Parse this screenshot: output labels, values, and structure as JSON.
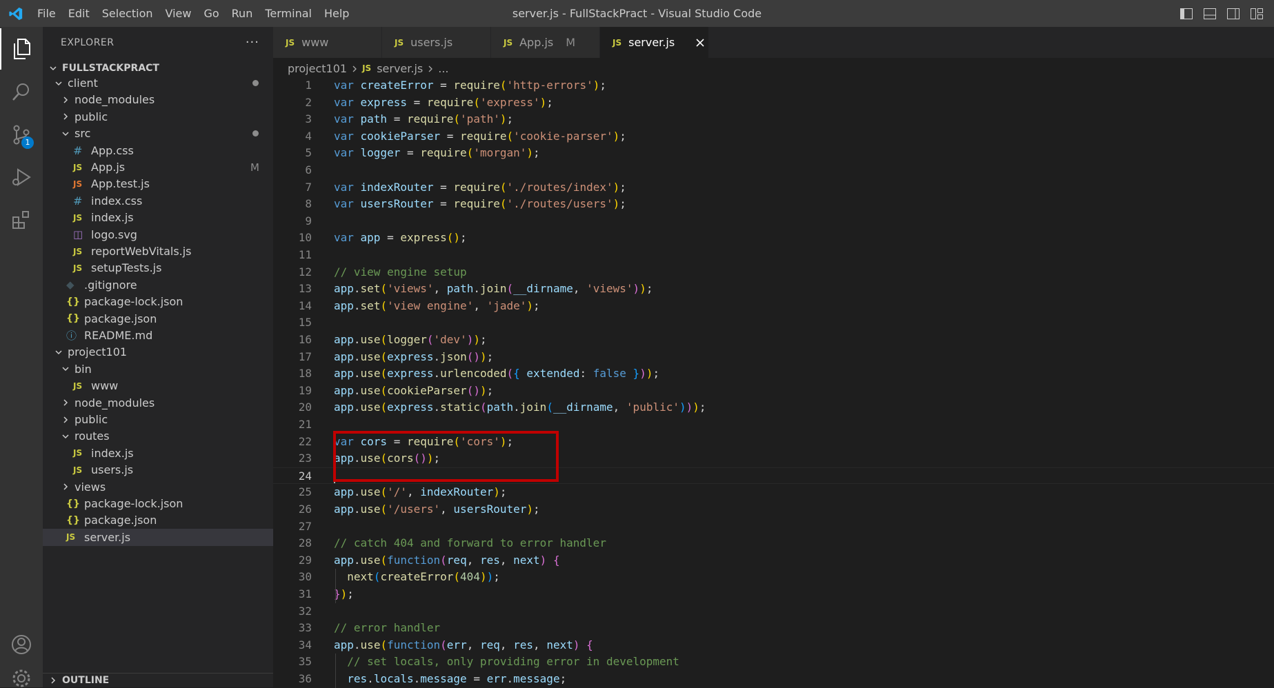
{
  "menu": [
    "File",
    "Edit",
    "Selection",
    "View",
    "Go",
    "Run",
    "Terminal",
    "Help"
  ],
  "window_title": "server.js - FullStackPract - Visual Studio Code",
  "activity": {
    "source_control_badge": "1"
  },
  "explorer": {
    "title": "EXPLORER",
    "more": "···",
    "root": "FULLSTACKPRACT",
    "outline": "OUTLINE",
    "tree": [
      {
        "label": "client",
        "type": "folder",
        "open": true,
        "depth": 1,
        "decoration": "dot"
      },
      {
        "label": "node_modules",
        "type": "folder",
        "open": false,
        "depth": 2
      },
      {
        "label": "public",
        "type": "folder",
        "open": false,
        "depth": 2
      },
      {
        "label": "src",
        "type": "folder",
        "open": true,
        "depth": 2,
        "decoration": "dot"
      },
      {
        "label": "App.css",
        "type": "css",
        "icon": "#",
        "depth": 3
      },
      {
        "label": "App.js",
        "type": "js",
        "icon": "JS",
        "depth": 3,
        "decoration": "M"
      },
      {
        "label": "App.test.js",
        "type": "jstest",
        "icon": "JS",
        "depth": 3
      },
      {
        "label": "index.css",
        "type": "css",
        "icon": "#",
        "depth": 3
      },
      {
        "label": "index.js",
        "type": "js",
        "icon": "JS",
        "depth": 3
      },
      {
        "label": "logo.svg",
        "type": "svg",
        "icon": "◫",
        "depth": 3
      },
      {
        "label": "reportWebVitals.js",
        "type": "js",
        "icon": "JS",
        "depth": 3
      },
      {
        "label": "setupTests.js",
        "type": "js",
        "icon": "JS",
        "depth": 3
      },
      {
        "label": ".gitignore",
        "type": "git",
        "icon": "◆",
        "depth": 2
      },
      {
        "label": "package-lock.json",
        "type": "json",
        "icon": "{}",
        "depth": 2
      },
      {
        "label": "package.json",
        "type": "json",
        "icon": "{}",
        "depth": 2
      },
      {
        "label": "README.md",
        "type": "info",
        "icon": "ⓘ",
        "depth": 2
      },
      {
        "label": "project101",
        "type": "folder",
        "open": true,
        "depth": 1
      },
      {
        "label": "bin",
        "type": "folder",
        "open": true,
        "depth": 2
      },
      {
        "label": "www",
        "type": "js",
        "icon": "JS",
        "depth": 3
      },
      {
        "label": "node_modules",
        "type": "folder",
        "open": false,
        "depth": 2
      },
      {
        "label": "public",
        "type": "folder",
        "open": false,
        "depth": 2
      },
      {
        "label": "routes",
        "type": "folder",
        "open": true,
        "depth": 2
      },
      {
        "label": "index.js",
        "type": "js",
        "icon": "JS",
        "depth": 3
      },
      {
        "label": "users.js",
        "type": "js",
        "icon": "JS",
        "depth": 3
      },
      {
        "label": "views",
        "type": "folder",
        "open": false,
        "depth": 2
      },
      {
        "label": "package-lock.json",
        "type": "json",
        "icon": "{}",
        "depth": 2
      },
      {
        "label": "package.json",
        "type": "json",
        "icon": "{}",
        "depth": 2
      },
      {
        "label": "server.js",
        "type": "js",
        "icon": "JS",
        "depth": 2,
        "selected": true
      }
    ]
  },
  "tabs": [
    {
      "label": "www",
      "icon": "JS",
      "active": false
    },
    {
      "label": "users.js",
      "icon": "JS",
      "active": false
    },
    {
      "label": "App.js",
      "icon": "JS",
      "active": false,
      "modified": "M"
    },
    {
      "label": "server.js",
      "icon": "JS",
      "active": true
    }
  ],
  "breadcrumb": {
    "folder": "project101",
    "file_icon": "JS",
    "file": "server.js",
    "trail": "..."
  },
  "editor": {
    "current_line": 24,
    "lines": [
      [
        [
          "kw",
          "var "
        ],
        [
          "vr",
          "createError"
        ],
        [
          "pn",
          " = "
        ],
        [
          "fn",
          "require"
        ],
        [
          "br1",
          "("
        ],
        [
          "st",
          "'http-errors'"
        ],
        [
          "br1",
          ")"
        ],
        [
          "pn",
          ";"
        ]
      ],
      [
        [
          "kw",
          "var "
        ],
        [
          "vr",
          "express"
        ],
        [
          "pn",
          " = "
        ],
        [
          "fn",
          "require"
        ],
        [
          "br1",
          "("
        ],
        [
          "st",
          "'express'"
        ],
        [
          "br1",
          ")"
        ],
        [
          "pn",
          ";"
        ]
      ],
      [
        [
          "kw",
          "var "
        ],
        [
          "vr",
          "path"
        ],
        [
          "pn",
          " = "
        ],
        [
          "fn",
          "require"
        ],
        [
          "br1",
          "("
        ],
        [
          "st",
          "'path'"
        ],
        [
          "br1",
          ")"
        ],
        [
          "pn",
          ";"
        ]
      ],
      [
        [
          "kw",
          "var "
        ],
        [
          "vr",
          "cookieParser"
        ],
        [
          "pn",
          " = "
        ],
        [
          "fn",
          "require"
        ],
        [
          "br1",
          "("
        ],
        [
          "st",
          "'cookie-parser'"
        ],
        [
          "br1",
          ")"
        ],
        [
          "pn",
          ";"
        ]
      ],
      [
        [
          "kw",
          "var "
        ],
        [
          "vr",
          "logger"
        ],
        [
          "pn",
          " = "
        ],
        [
          "fn",
          "require"
        ],
        [
          "br1",
          "("
        ],
        [
          "st",
          "'morgan'"
        ],
        [
          "br1",
          ")"
        ],
        [
          "pn",
          ";"
        ]
      ],
      [],
      [
        [
          "kw",
          "var "
        ],
        [
          "vr",
          "indexRouter"
        ],
        [
          "pn",
          " = "
        ],
        [
          "fn",
          "require"
        ],
        [
          "br1",
          "("
        ],
        [
          "st",
          "'./routes/index'"
        ],
        [
          "br1",
          ")"
        ],
        [
          "pn",
          ";"
        ]
      ],
      [
        [
          "kw",
          "var "
        ],
        [
          "vr",
          "usersRouter"
        ],
        [
          "pn",
          " = "
        ],
        [
          "fn",
          "require"
        ],
        [
          "br1",
          "("
        ],
        [
          "st",
          "'./routes/users'"
        ],
        [
          "br1",
          ")"
        ],
        [
          "pn",
          ";"
        ]
      ],
      [],
      [
        [
          "kw",
          "var "
        ],
        [
          "vr",
          "app"
        ],
        [
          "pn",
          " = "
        ],
        [
          "fn",
          "express"
        ],
        [
          "br1",
          "()"
        ],
        [
          "pn",
          ";"
        ]
      ],
      [],
      [
        [
          "cm",
          "// view engine setup"
        ]
      ],
      [
        [
          "vr",
          "app"
        ],
        [
          "pn",
          "."
        ],
        [
          "fn",
          "set"
        ],
        [
          "br1",
          "("
        ],
        [
          "st",
          "'views'"
        ],
        [
          "pn",
          ", "
        ],
        [
          "vr",
          "path"
        ],
        [
          "pn",
          "."
        ],
        [
          "fn",
          "join"
        ],
        [
          "br2",
          "("
        ],
        [
          "vr",
          "__dirname"
        ],
        [
          "pn",
          ", "
        ],
        [
          "st",
          "'views'"
        ],
        [
          "br2",
          ")"
        ],
        [
          "br1",
          ")"
        ],
        [
          "pn",
          ";"
        ]
      ],
      [
        [
          "vr",
          "app"
        ],
        [
          "pn",
          "."
        ],
        [
          "fn",
          "set"
        ],
        [
          "br1",
          "("
        ],
        [
          "st",
          "'view engine'"
        ],
        [
          "pn",
          ", "
        ],
        [
          "st",
          "'jade'"
        ],
        [
          "br1",
          ")"
        ],
        [
          "pn",
          ";"
        ]
      ],
      [],
      [
        [
          "vr",
          "app"
        ],
        [
          "pn",
          "."
        ],
        [
          "fn",
          "use"
        ],
        [
          "br1",
          "("
        ],
        [
          "fn",
          "logger"
        ],
        [
          "br2",
          "("
        ],
        [
          "st",
          "'dev'"
        ],
        [
          "br2",
          ")"
        ],
        [
          "br1",
          ")"
        ],
        [
          "pn",
          ";"
        ]
      ],
      [
        [
          "vr",
          "app"
        ],
        [
          "pn",
          "."
        ],
        [
          "fn",
          "use"
        ],
        [
          "br1",
          "("
        ],
        [
          "vr",
          "express"
        ],
        [
          "pn",
          "."
        ],
        [
          "fn",
          "json"
        ],
        [
          "br2",
          "()"
        ],
        [
          "br1",
          ")"
        ],
        [
          "pn",
          ";"
        ]
      ],
      [
        [
          "vr",
          "app"
        ],
        [
          "pn",
          "."
        ],
        [
          "fn",
          "use"
        ],
        [
          "br1",
          "("
        ],
        [
          "vr",
          "express"
        ],
        [
          "pn",
          "."
        ],
        [
          "fn",
          "urlencoded"
        ],
        [
          "br2",
          "("
        ],
        [
          "br3",
          "{"
        ],
        [
          "vr",
          " extended"
        ],
        [
          "pn",
          ": "
        ],
        [
          "kw",
          "false"
        ],
        [
          "br3",
          " }"
        ],
        [
          "br2",
          ")"
        ],
        [
          "br1",
          ")"
        ],
        [
          "pn",
          ";"
        ]
      ],
      [
        [
          "vr",
          "app"
        ],
        [
          "pn",
          "."
        ],
        [
          "fn",
          "use"
        ],
        [
          "br1",
          "("
        ],
        [
          "fn",
          "cookieParser"
        ],
        [
          "br2",
          "()"
        ],
        [
          "br1",
          ")"
        ],
        [
          "pn",
          ";"
        ]
      ],
      [
        [
          "vr",
          "app"
        ],
        [
          "pn",
          "."
        ],
        [
          "fn",
          "use"
        ],
        [
          "br1",
          "("
        ],
        [
          "vr",
          "express"
        ],
        [
          "pn",
          "."
        ],
        [
          "fn",
          "static"
        ],
        [
          "br2",
          "("
        ],
        [
          "vr",
          "path"
        ],
        [
          "pn",
          "."
        ],
        [
          "fn",
          "join"
        ],
        [
          "br3",
          "("
        ],
        [
          "vr",
          "__dirname"
        ],
        [
          "pn",
          ", "
        ],
        [
          "st",
          "'public'"
        ],
        [
          "br3",
          ")"
        ],
        [
          "br2",
          ")"
        ],
        [
          "br1",
          ")"
        ],
        [
          "pn",
          ";"
        ]
      ],
      [],
      [
        [
          "kw",
          "var "
        ],
        [
          "vr",
          "cors"
        ],
        [
          "pn",
          " = "
        ],
        [
          "fn",
          "require"
        ],
        [
          "br1",
          "("
        ],
        [
          "st",
          "'cors'"
        ],
        [
          "br1",
          ")"
        ],
        [
          "pn",
          ";"
        ]
      ],
      [
        [
          "vr",
          "app"
        ],
        [
          "pn",
          "."
        ],
        [
          "fn",
          "use"
        ],
        [
          "br1",
          "("
        ],
        [
          "fn",
          "cors"
        ],
        [
          "br2",
          "()"
        ],
        [
          "br1",
          ")"
        ],
        [
          "pn",
          ";"
        ]
      ],
      [],
      [
        [
          "vr",
          "app"
        ],
        [
          "pn",
          "."
        ],
        [
          "fn",
          "use"
        ],
        [
          "br1",
          "("
        ],
        [
          "st",
          "'/'"
        ],
        [
          "pn",
          ", "
        ],
        [
          "vr",
          "indexRouter"
        ],
        [
          "br1",
          ")"
        ],
        [
          "pn",
          ";"
        ]
      ],
      [
        [
          "vr",
          "app"
        ],
        [
          "pn",
          "."
        ],
        [
          "fn",
          "use"
        ],
        [
          "br1",
          "("
        ],
        [
          "st",
          "'/users'"
        ],
        [
          "pn",
          ", "
        ],
        [
          "vr",
          "usersRouter"
        ],
        [
          "br1",
          ")"
        ],
        [
          "pn",
          ";"
        ]
      ],
      [],
      [
        [
          "cm",
          "// catch 404 and forward to error handler"
        ]
      ],
      [
        [
          "vr",
          "app"
        ],
        [
          "pn",
          "."
        ],
        [
          "fn",
          "use"
        ],
        [
          "br1",
          "("
        ],
        [
          "kw",
          "function"
        ],
        [
          "br2",
          "("
        ],
        [
          "vr",
          "req"
        ],
        [
          "pn",
          ", "
        ],
        [
          "vr",
          "res"
        ],
        [
          "pn",
          ", "
        ],
        [
          "vr",
          "next"
        ],
        [
          "br2",
          ")"
        ],
        [
          "pn",
          " "
        ],
        [
          "br2",
          "{"
        ]
      ],
      [
        [
          "pn",
          "  "
        ],
        [
          "fn",
          "next"
        ],
        [
          "br3",
          "("
        ],
        [
          "fn",
          "createError"
        ],
        [
          "br1",
          "("
        ],
        [
          "nm",
          "404"
        ],
        [
          "br1",
          ")"
        ],
        [
          "br3",
          ")"
        ],
        [
          "pn",
          ";"
        ]
      ],
      [
        [
          "br2",
          "}"
        ],
        [
          "br1",
          ")"
        ],
        [
          "pn",
          ";"
        ]
      ],
      [],
      [
        [
          "cm",
          "// error handler"
        ]
      ],
      [
        [
          "vr",
          "app"
        ],
        [
          "pn",
          "."
        ],
        [
          "fn",
          "use"
        ],
        [
          "br1",
          "("
        ],
        [
          "kw",
          "function"
        ],
        [
          "br2",
          "("
        ],
        [
          "vr",
          "err"
        ],
        [
          "pn",
          ", "
        ],
        [
          "vr",
          "req"
        ],
        [
          "pn",
          ", "
        ],
        [
          "vr",
          "res"
        ],
        [
          "pn",
          ", "
        ],
        [
          "vr",
          "next"
        ],
        [
          "br2",
          ")"
        ],
        [
          "pn",
          " "
        ],
        [
          "br2",
          "{"
        ]
      ],
      [
        [
          "pn",
          "  "
        ],
        [
          "cm",
          "// set locals, only providing error in development"
        ]
      ],
      [
        [
          "pn",
          "  "
        ],
        [
          "vr",
          "res"
        ],
        [
          "pn",
          "."
        ],
        [
          "vr",
          "locals"
        ],
        [
          "pn",
          "."
        ],
        [
          "vr",
          "message"
        ],
        [
          "pn",
          " = "
        ],
        [
          "vr",
          "err"
        ],
        [
          "pn",
          "."
        ],
        [
          "vr",
          "message"
        ],
        [
          "pn",
          ";"
        ]
      ]
    ]
  }
}
